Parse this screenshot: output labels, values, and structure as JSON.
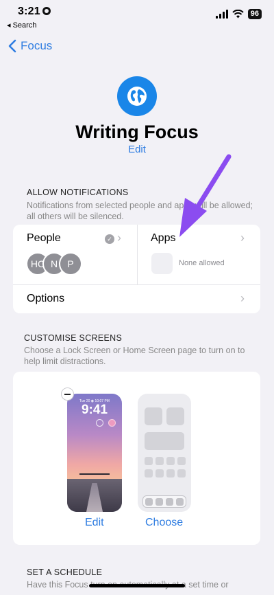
{
  "status_bar": {
    "time": "3:21",
    "back_app": "◂ Search",
    "battery": "96"
  },
  "nav": {
    "back_label": "Focus"
  },
  "focus": {
    "title": "Writing Focus",
    "edit_label": "Edit"
  },
  "allow_notifications": {
    "header": "ALLOW NOTIFICATIONS",
    "description": "Notifications from selected people and apps will be allowed; all others will be silenced.",
    "people_label": "People",
    "avatars": [
      "HC",
      "N",
      "P"
    ],
    "apps_label": "Apps",
    "apps_status": "None allowed",
    "options_label": "Options"
  },
  "customise_screens": {
    "header": "CUSTOMISE SCREENS",
    "description": "Choose a Lock Screen or Home Screen page to turn on to help limit distractions.",
    "lock_date": "Tue 20 ◉ 10:07 PM",
    "lock_time": "9:41",
    "edit_label": "Edit",
    "choose_label": "Choose"
  },
  "schedule": {
    "header": "SET A SCHEDULE",
    "description": "Have this Focus turn on automatically at a set time or location, or while using a certain app."
  },
  "colors": {
    "accent": "#2f7de1",
    "focus_icon": "#1a86e8",
    "annotation_arrow": "#8b4cf0"
  }
}
